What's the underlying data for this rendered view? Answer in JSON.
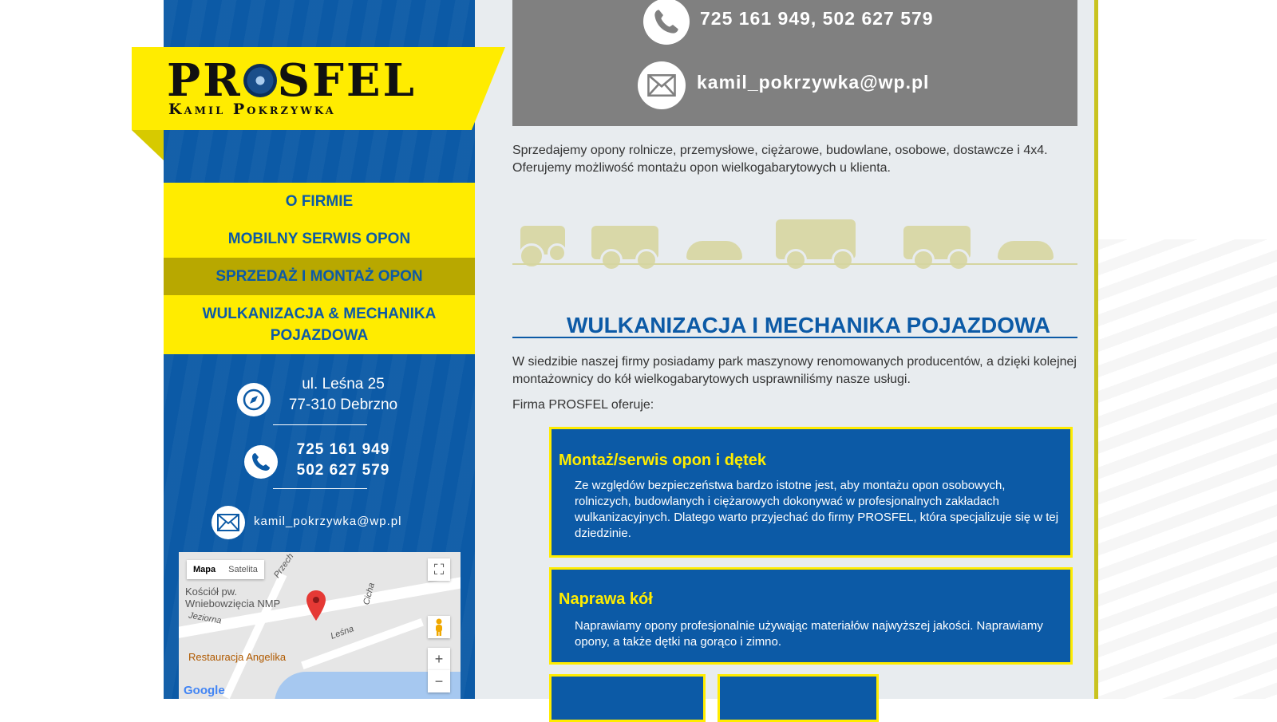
{
  "brand": {
    "name": "PROSFEL",
    "name_part1": "PR",
    "name_part2": "SFEL",
    "owner": "Kamil Pokrzywka"
  },
  "nav": {
    "items": [
      {
        "label": "O FIRMIE"
      },
      {
        "label": "MOBILNY SERWIS OPON"
      },
      {
        "label": "SPRZEDAŻ I MONTAŻ OPON"
      },
      {
        "label": "WULKANIZACJA & MECHANIKA POJAZDOWA"
      }
    ]
  },
  "sidebar_contact": {
    "street": "ul. Leśna 25",
    "city": "77-310 Debrzno",
    "phone1": "725 161 949",
    "phone2": "502 627 579",
    "email": "kamil_pokrzywka@wp.pl"
  },
  "map": {
    "tab_map": "Mapa",
    "tab_satellite": "Satelita",
    "label_church": "Kościół pw. Wniebowzięcia NMP",
    "label_restaurant": "Restauracja Angelika",
    "label_street1": "Jeziorna",
    "label_street2": "Leśna",
    "label_street3": "Cicha",
    "label_street4": "Przech",
    "zoom_in": "+",
    "zoom_out": "−",
    "google": "Google"
  },
  "header_contact": {
    "phones": "725 161 949, 502 627 579",
    "email": "kamil_pokrzywka@wp.pl"
  },
  "intro": "Sprzedajemy opony rolnicze, przemysłowe, ciężarowe, budowlane, osobowe, dostawcze i 4x4. Oferujemy możliwość montażu opon wielkogabarytowych u klienta.",
  "section": {
    "title": "WULKANIZACJA I MECHANIKA POJAZDOWA",
    "text": "W siedzibie naszej firmy posiadamy park maszynowy renomowanych producentów, a dzięki kolejnej montażownicy do kół wielkogabarytowych usprawniliśmy nasze usługi.",
    "offers_label": "Firma PROSFEL oferuje:"
  },
  "cards": [
    {
      "title": "Montaż/serwis opon i dętek",
      "text": "Ze względów bezpieczeństwa bardzo istotne jest, aby montażu opon osobowych, rolniczych, budowlanych i ciężarowych dokonywać w profesjonalnych zakładach wulkanizacyjnych. Dlatego warto przyjechać do firmy PROSFEL, która specjalizuje się w tej dziedzinie."
    },
    {
      "title": "Naprawa kół",
      "text": "Naprawiamy opony profesjonalnie używając materiałów najwyższej jakości. Naprawiamy opony, a także dętki na gorąco i zimno."
    }
  ],
  "colors": {
    "primary": "#0c5aa6",
    "accent": "#ffec00",
    "active": "#b8a800",
    "gray": "#808080"
  }
}
